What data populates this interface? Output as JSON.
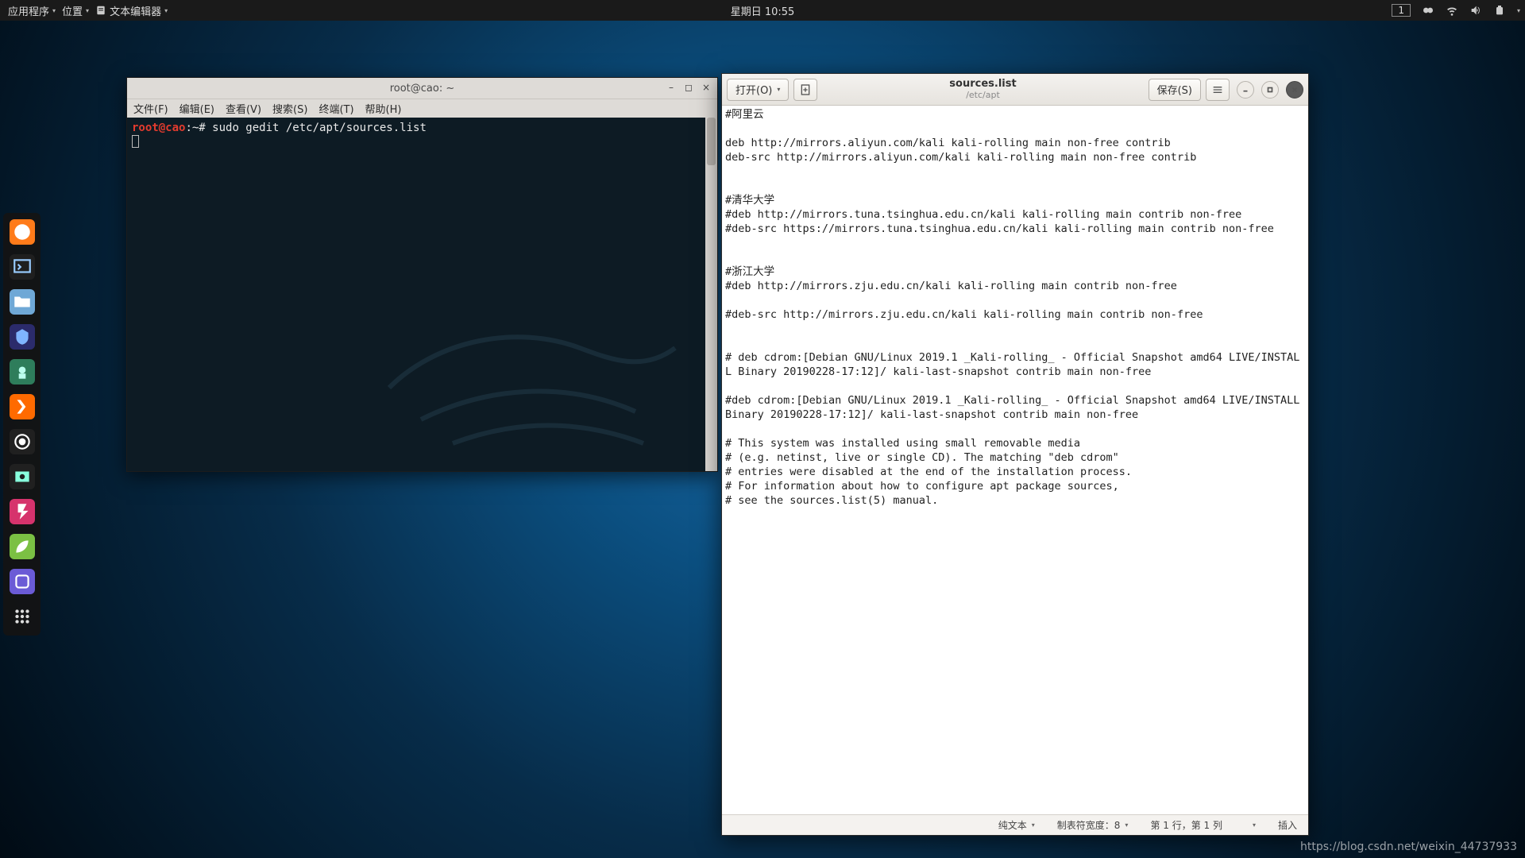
{
  "panel": {
    "applications": "应用程序",
    "places": "位置",
    "active_app": "文本编辑器",
    "clock": "星期日 10:55",
    "workspace": "1"
  },
  "dock": {
    "items": [
      "firefox",
      "terminal",
      "files",
      "metasploit",
      "burpsuite",
      "armitage",
      "obs",
      "recorder",
      "faraday",
      "leaf",
      "atom",
      "activities"
    ]
  },
  "terminal": {
    "title": "root@cao: ~",
    "menus": {
      "file": "文件(F)",
      "edit": "编辑(E)",
      "view": "查看(V)",
      "search": "搜索(S)",
      "terminal": "终端(T)",
      "help": "帮助(H)"
    },
    "prompt_user": "root@cao",
    "prompt_sep": ":",
    "prompt_path": "~#",
    "command": " sudo gedit /etc/apt/sources.list"
  },
  "gedit": {
    "open": "打开(O)",
    "save": "保存(S)",
    "filename": "sources.list",
    "filepath": "/etc/apt",
    "content": "#阿里云\n\ndeb http://mirrors.aliyun.com/kali kali-rolling main non-free contrib\ndeb-src http://mirrors.aliyun.com/kali kali-rolling main non-free contrib\n\n\n#清华大学\n#deb http://mirrors.tuna.tsinghua.edu.cn/kali kali-rolling main contrib non-free\n#deb-src https://mirrors.tuna.tsinghua.edu.cn/kali kali-rolling main contrib non-free\n\n\n#浙江大学\n#deb http://mirrors.zju.edu.cn/kali kali-rolling main contrib non-free\n\n#deb-src http://mirrors.zju.edu.cn/kali kali-rolling main contrib non-free\n\n\n# deb cdrom:[Debian GNU/Linux 2019.1 _Kali-rolling_ - Official Snapshot amd64 LIVE/INSTALL Binary 20190228-17:12]/ kali-last-snapshot contrib main non-free\n\n#deb cdrom:[Debian GNU/Linux 2019.1 _Kali-rolling_ - Official Snapshot amd64 LIVE/INSTALL Binary 20190228-17:12]/ kali-last-snapshot contrib main non-free\n\n# This system was installed using small removable media\n# (e.g. netinst, live or single CD). The matching \"deb cdrom\"\n# entries were disabled at the end of the installation process.\n# For information about how to configure apt package sources,\n# see the sources.list(5) manual.",
    "status": {
      "syntax": "纯文本",
      "tabwidth": "制表符宽度：8",
      "position": "第 1 行，第 1 列",
      "insert": "插入"
    }
  },
  "watermark": "https://blog.csdn.net/weixin_44737933"
}
